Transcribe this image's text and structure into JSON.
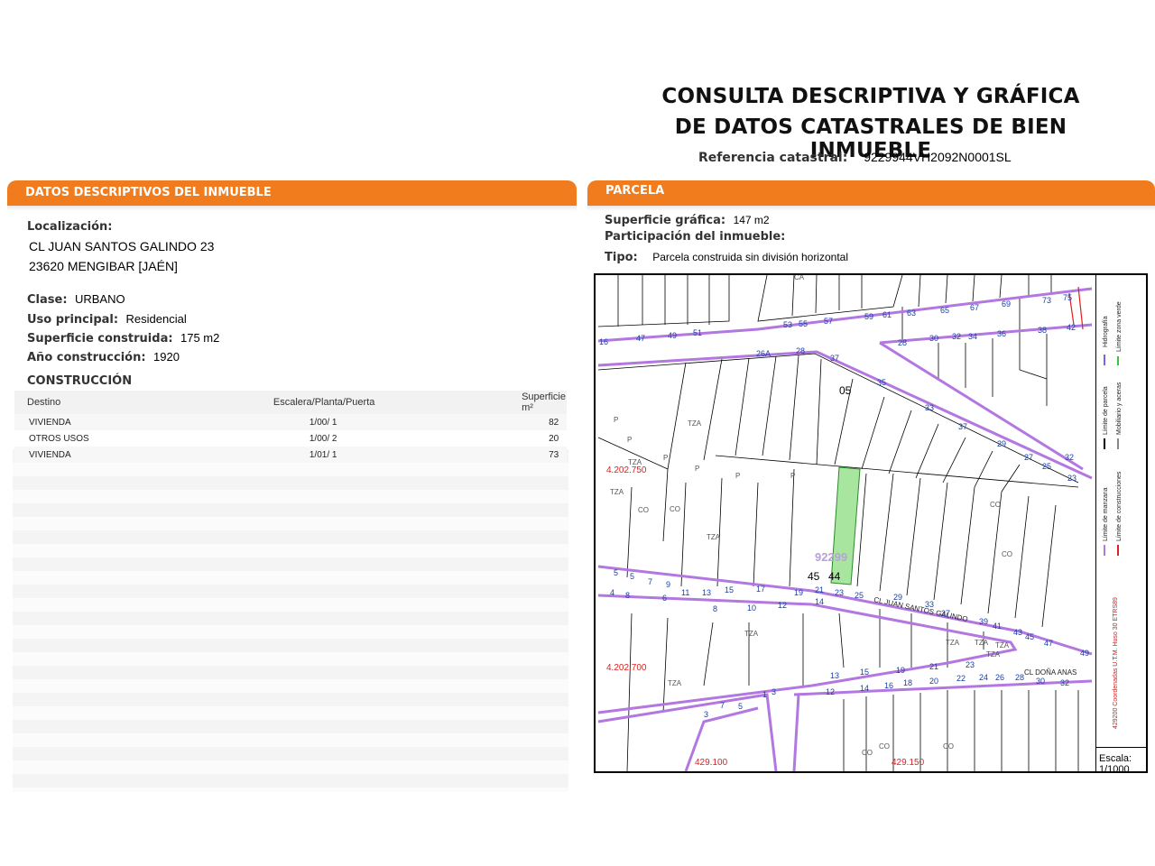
{
  "header": {
    "title_line1": "CONSULTA DESCRIPTIVA Y GRÁFICA",
    "title_line2": "DE DATOS CATASTRALES DE BIEN INMUEBLE",
    "ref_label": "Referencia catastral:",
    "ref_value": "9229944VH2092N0001SL"
  },
  "left_panel": {
    "header": "DATOS DESCRIPTIVOS DEL INMUEBLE",
    "localizacion_label": "Localización:",
    "address_line1": "CL JUAN SANTOS GALINDO 23",
    "address_line2": "23620 MENGIBAR [JAÉN]",
    "clase_label": "Clase:",
    "clase_value": "URBANO",
    "uso_label": "Uso principal:",
    "uso_value": "Residencial",
    "superficie_label": "Superficie construida:",
    "superficie_value": "175 m2",
    "anio_label": "Año construcción:",
    "anio_value": "1920",
    "construccion_heading": "CONSTRUCCIÓN",
    "table_headers": [
      "Destino",
      "Escalera/Planta/Puerta",
      "Superficie m²"
    ],
    "rows": [
      [
        "VIVIENDA",
        "1/00/ 1",
        "82"
      ],
      [
        "OTROS USOS",
        "1/00/ 2",
        "20"
      ],
      [
        "VIVIENDA",
        "1/01/ 1",
        "73"
      ]
    ]
  },
  "right_panel": {
    "header": "PARCELA",
    "superficie_label": "Superficie gráfica:",
    "superficie_value": "147 m2",
    "participacion_label": "Participación del inmueble:",
    "tipo_label": "Tipo:",
    "tipo_value": "Parcela construida sin división horizontal"
  },
  "map": {
    "parcel_id": "92299",
    "street_label": "CL JUAN SANTOS GALINDO",
    "street2_label": "CL DOÑA ANAS",
    "coord_tl": "4.202.750",
    "coord_bl": "4.202.700",
    "coord_b1": "429.100",
    "coord_b2": "429.150",
    "legend": {
      "hidrografia": "Hidrografía",
      "limite_zona_verde": "Límite zona verde",
      "limite_parcela": "Límite de parcela",
      "mobiliario": "Mobiliario y aceras",
      "limite_manzana": "Límite de manzana",
      "limite_construcciones": "Límite de construcciones",
      "coordenadas": "429200 Coordenadas U.T.M. Huso 30 ETRS89"
    },
    "scale_label": "Escala:",
    "scale_value": "1/1000",
    "colors": {
      "block": "#b277e0",
      "number": "#1a3fa8",
      "coord": "#e02020",
      "parcel_fill": "#a8e6a0"
    }
  }
}
